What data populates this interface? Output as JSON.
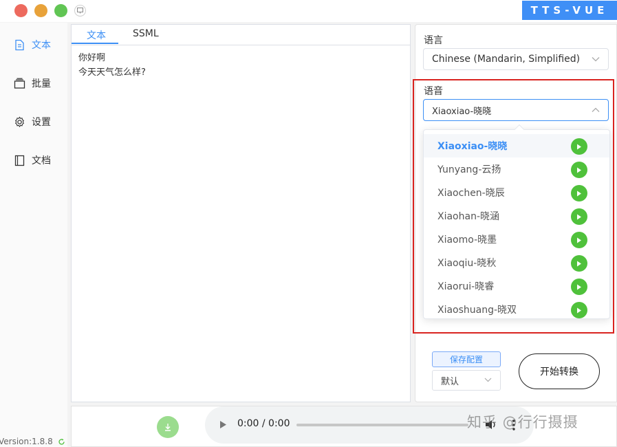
{
  "app": {
    "brand": "TTS-VUE",
    "version": "Version:1.8.8"
  },
  "sidebar": {
    "items": [
      {
        "label": "文本",
        "icon": "document-icon",
        "active": true
      },
      {
        "label": "批量",
        "icon": "stack-icon",
        "active": false
      },
      {
        "label": "设置",
        "icon": "gear-icon",
        "active": false
      },
      {
        "label": "文档",
        "icon": "book-icon",
        "active": false
      }
    ]
  },
  "editor": {
    "tabs": [
      "文本",
      "SSML"
    ],
    "active_tab": "文本",
    "text": "你好啊\n今天天气怎么样?"
  },
  "options": {
    "language_label": "语言",
    "language_value": "Chinese (Mandarin, Simplified)",
    "voice_label": "语音",
    "voice_value": "Xiaoxiao-晓晓",
    "voice_options": [
      "Xiaoxiao-晓晓",
      "Yunyang-云扬",
      "Xiaochen-晓辰",
      "Xiaohan-晓涵",
      "Xiaomo-晓墨",
      "Xiaoqiu-晓秋",
      "Xiaorui-晓睿",
      "Xiaoshuang-晓双"
    ],
    "save_config": "保存配置",
    "preset_value": "默认",
    "convert": "开始转换"
  },
  "player": {
    "time": "0:00 / 0:00"
  },
  "watermark": "知乎 @行行摄摄",
  "colors": {
    "accent": "#3c8ff5",
    "play_green": "#4fc13b",
    "highlight_red": "#d9231f"
  }
}
